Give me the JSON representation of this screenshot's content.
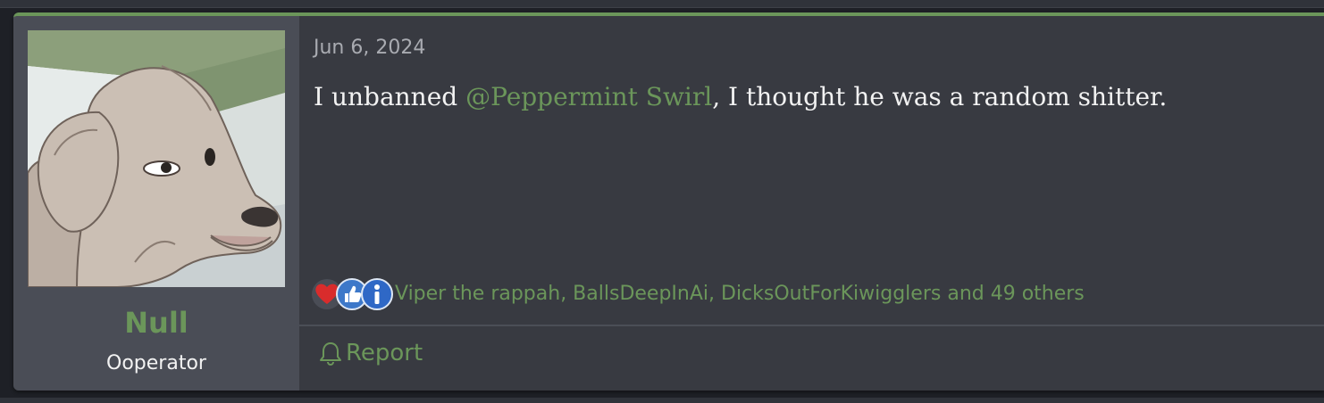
{
  "post": {
    "date": "Jun 6, 2024",
    "author": {
      "name": "Null",
      "title": "Ooperator",
      "avatar_icon": "dog-avatar"
    },
    "body": {
      "prefix": "I unbanned ",
      "mention": "@Peppermint Swirl",
      "suffix": ", I thought he was a random shitter."
    },
    "reactions": {
      "icons": [
        "heart-icon",
        "thumbs-up-icon",
        "informative-icon"
      ],
      "summary": "Viper the rappah, BallsDeepInAi, DicksOutForKiwigglers and 49 others"
    },
    "actions": {
      "report_label": "Report",
      "report_icon": "bell-icon"
    }
  },
  "colors": {
    "accent": "#6b965a",
    "post_background": "#383a41",
    "user_column": "#4a4d56",
    "text": "#f2f2f2",
    "muted_text": "#a9abb1"
  }
}
